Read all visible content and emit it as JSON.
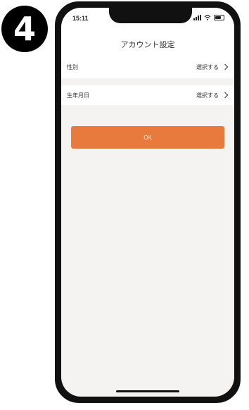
{
  "step_badge": "4",
  "status_bar": {
    "time": "15:11"
  },
  "header": {
    "title": "アカウント設定"
  },
  "settings": [
    {
      "label": "性別",
      "action": "選択する"
    },
    {
      "label": "生年月日",
      "action": "選択する"
    }
  ],
  "ok_button": {
    "label": "OK",
    "color": "#e87a3d"
  }
}
